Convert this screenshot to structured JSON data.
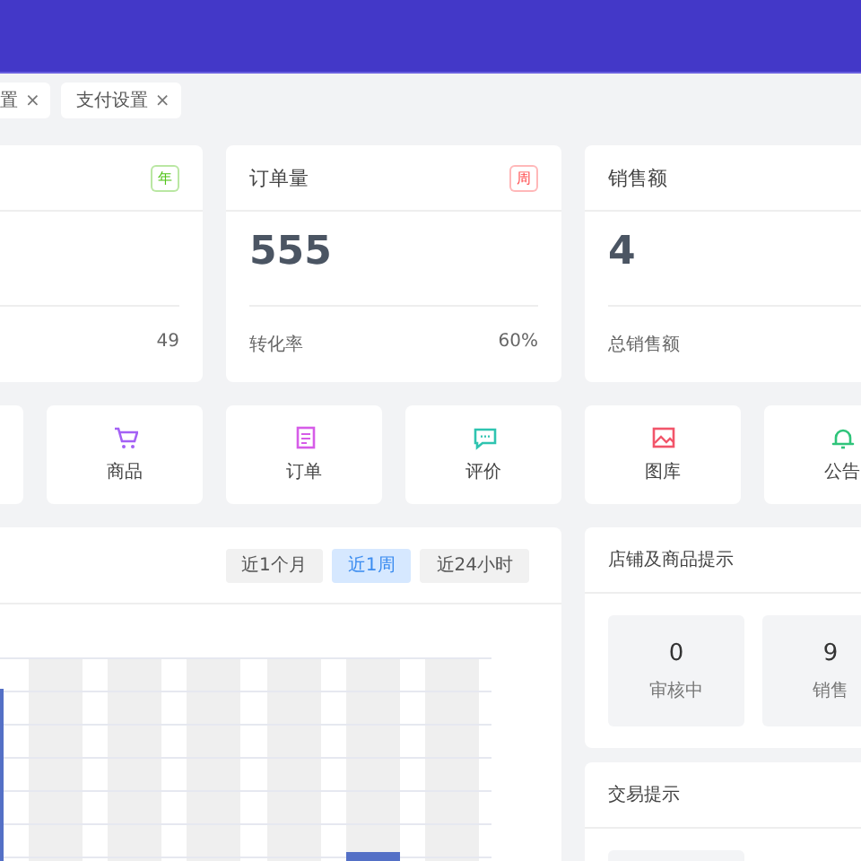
{
  "tabs": [
    {
      "label": "置",
      "close": "×"
    },
    {
      "label": "支付设置",
      "close": "×"
    }
  ],
  "stat_cards": [
    {
      "tag": "年",
      "color": "#52c41a",
      "footer_value": "49"
    },
    {
      "title": "订单量",
      "tag": "周",
      "color": "#ff4d4f",
      "value": "555",
      "footer_label": "转化率",
      "footer_value": "60%"
    },
    {
      "title": "销售额",
      "value": "4",
      "footer_label": "总销售额"
    }
  ],
  "shortcuts": [
    {
      "kind": "cart",
      "label": "商品",
      "color": "#a461f5"
    },
    {
      "kind": "document",
      "label": "订单",
      "color": "#d65ce8"
    },
    {
      "kind": "chat",
      "label": "评价",
      "color": "#2ec4b0"
    },
    {
      "kind": "image",
      "label": "图库",
      "color": "#f2556a"
    },
    {
      "kind": "bell",
      "label": "公告",
      "color": "#2fc47a"
    }
  ],
  "chart_panel": {
    "ranges": [
      {
        "label": "近1个月",
        "selected": false
      },
      {
        "label": "近1周",
        "selected": true
      },
      {
        "label": "近24小时",
        "selected": false
      }
    ]
  },
  "shop_tips": {
    "title": "店铺及商品提示",
    "items": [
      {
        "value": "0",
        "label": "审核中"
      },
      {
        "value": "9",
        "label": "销售"
      }
    ]
  },
  "trade_tips": {
    "title": "交易提示"
  }
}
